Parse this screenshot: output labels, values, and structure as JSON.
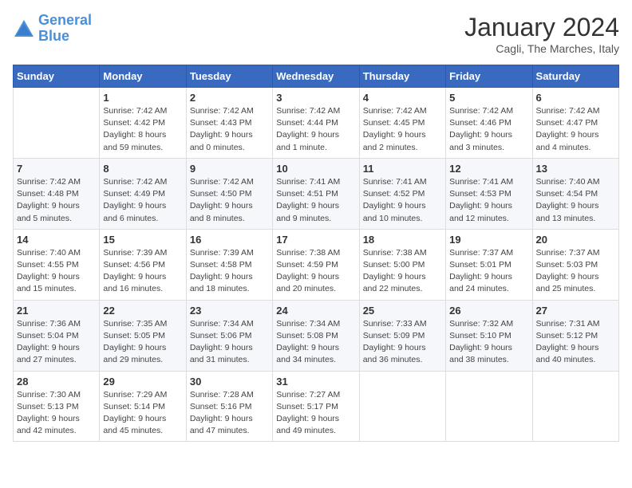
{
  "header": {
    "logo_line1": "General",
    "logo_line2": "Blue",
    "month_title": "January 2024",
    "location": "Cagli, The Marches, Italy"
  },
  "weekdays": [
    "Sunday",
    "Monday",
    "Tuesday",
    "Wednesday",
    "Thursday",
    "Friday",
    "Saturday"
  ],
  "weeks": [
    [
      {
        "day": "",
        "info": ""
      },
      {
        "day": "1",
        "info": "Sunrise: 7:42 AM\nSunset: 4:42 PM\nDaylight: 8 hours\nand 59 minutes."
      },
      {
        "day": "2",
        "info": "Sunrise: 7:42 AM\nSunset: 4:43 PM\nDaylight: 9 hours\nand 0 minutes."
      },
      {
        "day": "3",
        "info": "Sunrise: 7:42 AM\nSunset: 4:44 PM\nDaylight: 9 hours\nand 1 minute."
      },
      {
        "day": "4",
        "info": "Sunrise: 7:42 AM\nSunset: 4:45 PM\nDaylight: 9 hours\nand 2 minutes."
      },
      {
        "day": "5",
        "info": "Sunrise: 7:42 AM\nSunset: 4:46 PM\nDaylight: 9 hours\nand 3 minutes."
      },
      {
        "day": "6",
        "info": "Sunrise: 7:42 AM\nSunset: 4:47 PM\nDaylight: 9 hours\nand 4 minutes."
      }
    ],
    [
      {
        "day": "7",
        "info": "Sunrise: 7:42 AM\nSunset: 4:48 PM\nDaylight: 9 hours\nand 5 minutes."
      },
      {
        "day": "8",
        "info": "Sunrise: 7:42 AM\nSunset: 4:49 PM\nDaylight: 9 hours\nand 6 minutes."
      },
      {
        "day": "9",
        "info": "Sunrise: 7:42 AM\nSunset: 4:50 PM\nDaylight: 9 hours\nand 8 minutes."
      },
      {
        "day": "10",
        "info": "Sunrise: 7:41 AM\nSunset: 4:51 PM\nDaylight: 9 hours\nand 9 minutes."
      },
      {
        "day": "11",
        "info": "Sunrise: 7:41 AM\nSunset: 4:52 PM\nDaylight: 9 hours\nand 10 minutes."
      },
      {
        "day": "12",
        "info": "Sunrise: 7:41 AM\nSunset: 4:53 PM\nDaylight: 9 hours\nand 12 minutes."
      },
      {
        "day": "13",
        "info": "Sunrise: 7:40 AM\nSunset: 4:54 PM\nDaylight: 9 hours\nand 13 minutes."
      }
    ],
    [
      {
        "day": "14",
        "info": "Sunrise: 7:40 AM\nSunset: 4:55 PM\nDaylight: 9 hours\nand 15 minutes."
      },
      {
        "day": "15",
        "info": "Sunrise: 7:39 AM\nSunset: 4:56 PM\nDaylight: 9 hours\nand 16 minutes."
      },
      {
        "day": "16",
        "info": "Sunrise: 7:39 AM\nSunset: 4:58 PM\nDaylight: 9 hours\nand 18 minutes."
      },
      {
        "day": "17",
        "info": "Sunrise: 7:38 AM\nSunset: 4:59 PM\nDaylight: 9 hours\nand 20 minutes."
      },
      {
        "day": "18",
        "info": "Sunrise: 7:38 AM\nSunset: 5:00 PM\nDaylight: 9 hours\nand 22 minutes."
      },
      {
        "day": "19",
        "info": "Sunrise: 7:37 AM\nSunset: 5:01 PM\nDaylight: 9 hours\nand 24 minutes."
      },
      {
        "day": "20",
        "info": "Sunrise: 7:37 AM\nSunset: 5:03 PM\nDaylight: 9 hours\nand 25 minutes."
      }
    ],
    [
      {
        "day": "21",
        "info": "Sunrise: 7:36 AM\nSunset: 5:04 PM\nDaylight: 9 hours\nand 27 minutes."
      },
      {
        "day": "22",
        "info": "Sunrise: 7:35 AM\nSunset: 5:05 PM\nDaylight: 9 hours\nand 29 minutes."
      },
      {
        "day": "23",
        "info": "Sunrise: 7:34 AM\nSunset: 5:06 PM\nDaylight: 9 hours\nand 31 minutes."
      },
      {
        "day": "24",
        "info": "Sunrise: 7:34 AM\nSunset: 5:08 PM\nDaylight: 9 hours\nand 34 minutes."
      },
      {
        "day": "25",
        "info": "Sunrise: 7:33 AM\nSunset: 5:09 PM\nDaylight: 9 hours\nand 36 minutes."
      },
      {
        "day": "26",
        "info": "Sunrise: 7:32 AM\nSunset: 5:10 PM\nDaylight: 9 hours\nand 38 minutes."
      },
      {
        "day": "27",
        "info": "Sunrise: 7:31 AM\nSunset: 5:12 PM\nDaylight: 9 hours\nand 40 minutes."
      }
    ],
    [
      {
        "day": "28",
        "info": "Sunrise: 7:30 AM\nSunset: 5:13 PM\nDaylight: 9 hours\nand 42 minutes."
      },
      {
        "day": "29",
        "info": "Sunrise: 7:29 AM\nSunset: 5:14 PM\nDaylight: 9 hours\nand 45 minutes."
      },
      {
        "day": "30",
        "info": "Sunrise: 7:28 AM\nSunset: 5:16 PM\nDaylight: 9 hours\nand 47 minutes."
      },
      {
        "day": "31",
        "info": "Sunrise: 7:27 AM\nSunset: 5:17 PM\nDaylight: 9 hours\nand 49 minutes."
      },
      {
        "day": "",
        "info": ""
      },
      {
        "day": "",
        "info": ""
      },
      {
        "day": "",
        "info": ""
      }
    ]
  ]
}
